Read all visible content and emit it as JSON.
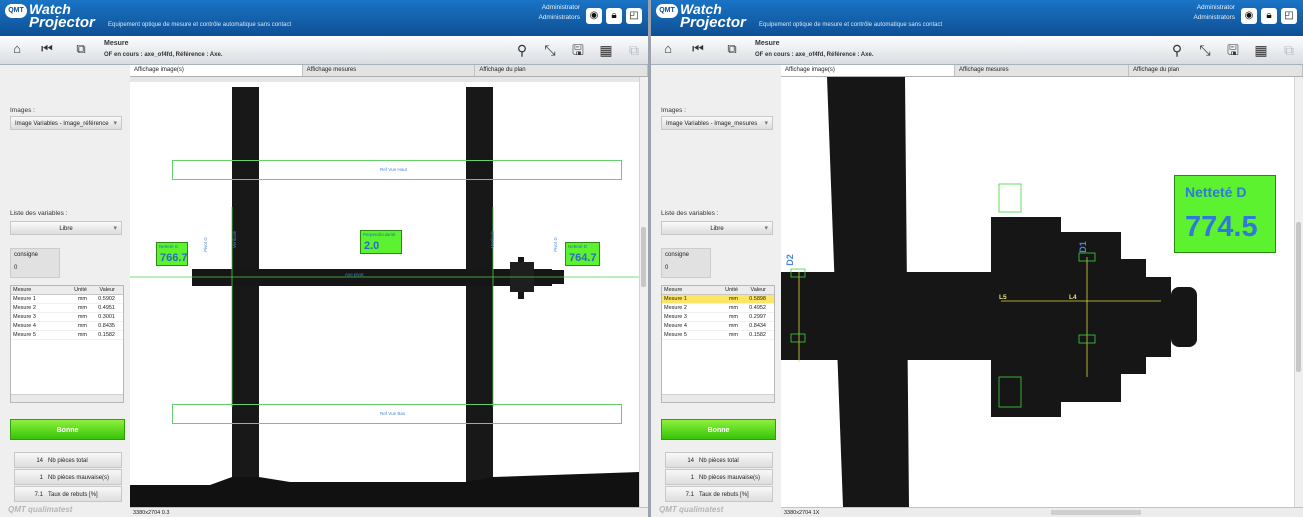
{
  "app": {
    "logo_badge": "QMT",
    "logo_line1": "Watch",
    "logo_line2": "Projector",
    "tagline": "Equipement optique de mesure et contrôle automatique sans contact",
    "user_line1": "Administrator",
    "user_line2": "Administrators",
    "header_icons": [
      "camera-icon",
      "lock-icon",
      "resize-icon"
    ]
  },
  "toolbar": {
    "title": "Mesure",
    "subtitle": "OF en cours : axe_of4fd, Référence : Axe.",
    "left_icons": [
      "home-icon",
      "skip-back-icon",
      "windows-icon"
    ],
    "right_icons": [
      "zoom-icon",
      "move-icon",
      "save-icon",
      "save-grid-icon",
      "layout-icon"
    ]
  },
  "left": {
    "images_label": "Images :",
    "images_value": "Image Variables - Image_référence",
    "variables_label": "Liste des variables :",
    "variables_value": "Libre",
    "consigne_label": "consigne",
    "consigne_value": "0",
    "table_headers": [
      "Mesure",
      "Unité",
      "Valeur"
    ],
    "rows": [
      {
        "name": "Mesure 1",
        "unit": "mm",
        "value": "0.5902"
      },
      {
        "name": "Mesure 2",
        "unit": "mm",
        "value": "0.4951"
      },
      {
        "name": "Mesure 3",
        "unit": "mm",
        "value": "0.3001"
      },
      {
        "name": "Mesure 4",
        "unit": "mm",
        "value": "0.8435"
      },
      {
        "name": "Mesure 5",
        "unit": "mm",
        "value": "0.1582"
      }
    ],
    "status": "Bonne",
    "stats": [
      {
        "n": "14",
        "label": "Nb pièces total"
      },
      {
        "n": "1",
        "label": "Nb pièces mauvaise(s)"
      },
      {
        "n": "7.1",
        "label": "Taux de rebuts [%]"
      }
    ],
    "tabs": [
      "Affichage image(s)",
      "Affichage mesures",
      "Affichage du plan"
    ],
    "status_bar": "3380x2704 0.3",
    "overlays": {
      "ref_top": "Ref Vue Haut",
      "ref_bottom": "Ref Vue Bas",
      "left_label": "Netteté G",
      "left_value": "766.7",
      "mid_label": "Perpendicularité",
      "mid_value": "2.0",
      "right_label": "Netteté D",
      "right_value": "764.7",
      "axis_label": "Axe pivot",
      "v_label_left": "Pivot G",
      "v_label_right": "Pivot D",
      "v_label_a": "Verticale",
      "v_label_b": "Verticale"
    }
  },
  "right": {
    "images_label": "Images :",
    "images_value": "Image Variables - Image_mesures",
    "variables_label": "Liste des variables :",
    "variables_value": "Libre",
    "consigne_label": "consigne",
    "consigne_value": "0",
    "table_headers": [
      "Mesure",
      "Unité",
      "Valeur"
    ],
    "rows": [
      {
        "name": "Mesure 1",
        "unit": "mm",
        "value": "0.5898"
      },
      {
        "name": "Mesure 2",
        "unit": "mm",
        "value": "0.4952"
      },
      {
        "name": "Mesure 3",
        "unit": "mm",
        "value": "0.2997"
      },
      {
        "name": "Mesure 4",
        "unit": "mm",
        "value": "0.8434"
      },
      {
        "name": "Mesure 5",
        "unit": "mm",
        "value": "0.1582"
      }
    ],
    "status": "Bonne",
    "stats": [
      {
        "n": "14",
        "label": "Nb pièces total"
      },
      {
        "n": "1",
        "label": "Nb pièces mauvaise(s)"
      },
      {
        "n": "7.1",
        "label": "Taux de rebuts [%]"
      }
    ],
    "tabs": [
      "Affichage image(s)",
      "Affichage mesures",
      "Affichage du plan"
    ],
    "status_bar": "3380x2704 1X",
    "overlays": {
      "sharp_label": "Netteté D",
      "sharp_value": "774.5",
      "d1": "D1",
      "d2": "D2",
      "l4": "L4",
      "l5": "L5"
    }
  },
  "colors": {
    "header_blue": "#1a74c5",
    "status_green": "#37c409",
    "overlay_green": "#5df22f",
    "overlay_text_blue": "#2b6bc3",
    "selected_row": "#ffe566"
  }
}
